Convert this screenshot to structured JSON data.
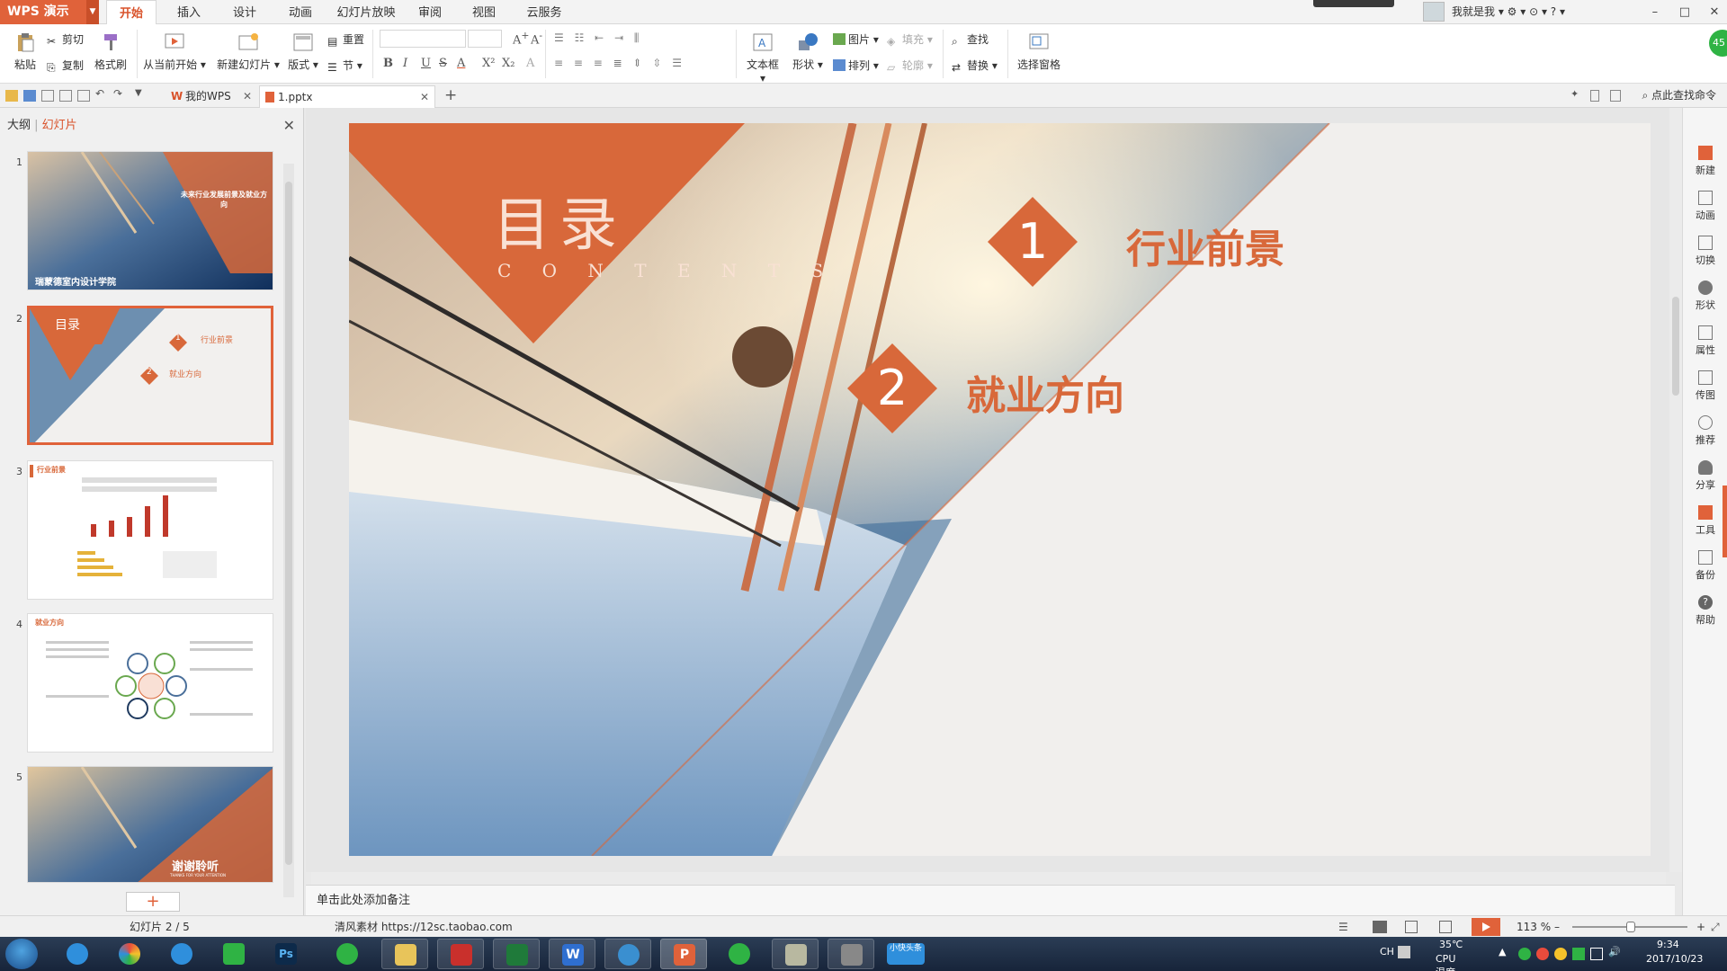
{
  "app": {
    "logo_label": "WPS 演示"
  },
  "menu": {
    "tabs": [
      {
        "label": "开始"
      },
      {
        "label": "插入"
      },
      {
        "label": "设计"
      },
      {
        "label": "动画"
      },
      {
        "label": "幻灯片放映"
      },
      {
        "label": "审阅"
      },
      {
        "label": "视图"
      },
      {
        "label": "云服务"
      }
    ],
    "user": "我就是我",
    "window_controls": [
      "–",
      "□",
      "✕"
    ]
  },
  "ribbon": {
    "paste": "粘贴",
    "cut": "剪切",
    "copy": "复制",
    "format_painter": "格式刷",
    "from_current": "从当前开始",
    "new_slide": "新建幻灯片",
    "layout": "版式",
    "reset": "重置",
    "section": "节",
    "bold": "B",
    "italic": "I",
    "underline": "U",
    "strike": "S",
    "font_color": "A",
    "superscript": "X²",
    "subscript": "X₂",
    "textbox": "文本框",
    "shape": "形状",
    "picture": "图片",
    "fill": "填充",
    "arrange": "排列",
    "outline": "轮廓",
    "find": "查找",
    "replace": "替换",
    "selection_pane": "选择窗格"
  },
  "tabbar": {
    "tabs": [
      {
        "label": "我的WPS"
      },
      {
        "label": "1.pptx"
      }
    ],
    "add": "+",
    "find_command": "点此查找命令"
  },
  "left_panel": {
    "tab_outline": "大纲",
    "tab_slides": "幻灯片",
    "close": "✕",
    "slide_numbers": [
      "1",
      "2",
      "3",
      "4",
      "5"
    ],
    "add": "+"
  },
  "thumbnails": {
    "s1_title": "未来行业发展前景及就业方向",
    "s1_footer": "瑞蒙德室内设计学院",
    "s2_title": "目录",
    "s2_item1_num": "1",
    "s2_item1": "行业前景",
    "s2_item2_num": "2",
    "s2_item2": "就业方向",
    "s3_title": "行业前景",
    "s4_title": "就业方向",
    "s5_title": "谢谢聆听",
    "s5_sub": "THANKS FOR YOUR ATTENTION"
  },
  "slide": {
    "title": "目录",
    "subtitle": "C O N T E N T S",
    "item1_num": "1",
    "item1_label": "行业前景",
    "item2_num": "2",
    "item2_label": "就业方向"
  },
  "notes": {
    "placeholder": "单击此处添加备注"
  },
  "right_panel": {
    "items": [
      {
        "label": "新建"
      },
      {
        "label": "动画"
      },
      {
        "label": "切换"
      },
      {
        "label": "形状"
      },
      {
        "label": "属性"
      },
      {
        "label": "传图"
      },
      {
        "label": "推荐"
      },
      {
        "label": "分享"
      },
      {
        "label": "工具"
      },
      {
        "label": "备份"
      },
      {
        "label": "帮助"
      }
    ],
    "badge": "45"
  },
  "status": {
    "slide_count": "幻灯片 2 / 5",
    "watermark": "清风素材 https://12sc.taobao.com",
    "zoom": "113 %",
    "zoom_minus": "–",
    "zoom_plus": "+"
  },
  "taskbar": {
    "ime": "CH",
    "temp": "35℃",
    "cpu_label": "CPU温度",
    "time": "9:34",
    "date": "2017/10/23",
    "xiaokuai": "小快头条"
  },
  "colors": {
    "accent": "#e0623a",
    "slide_orange": "#d8683a"
  }
}
